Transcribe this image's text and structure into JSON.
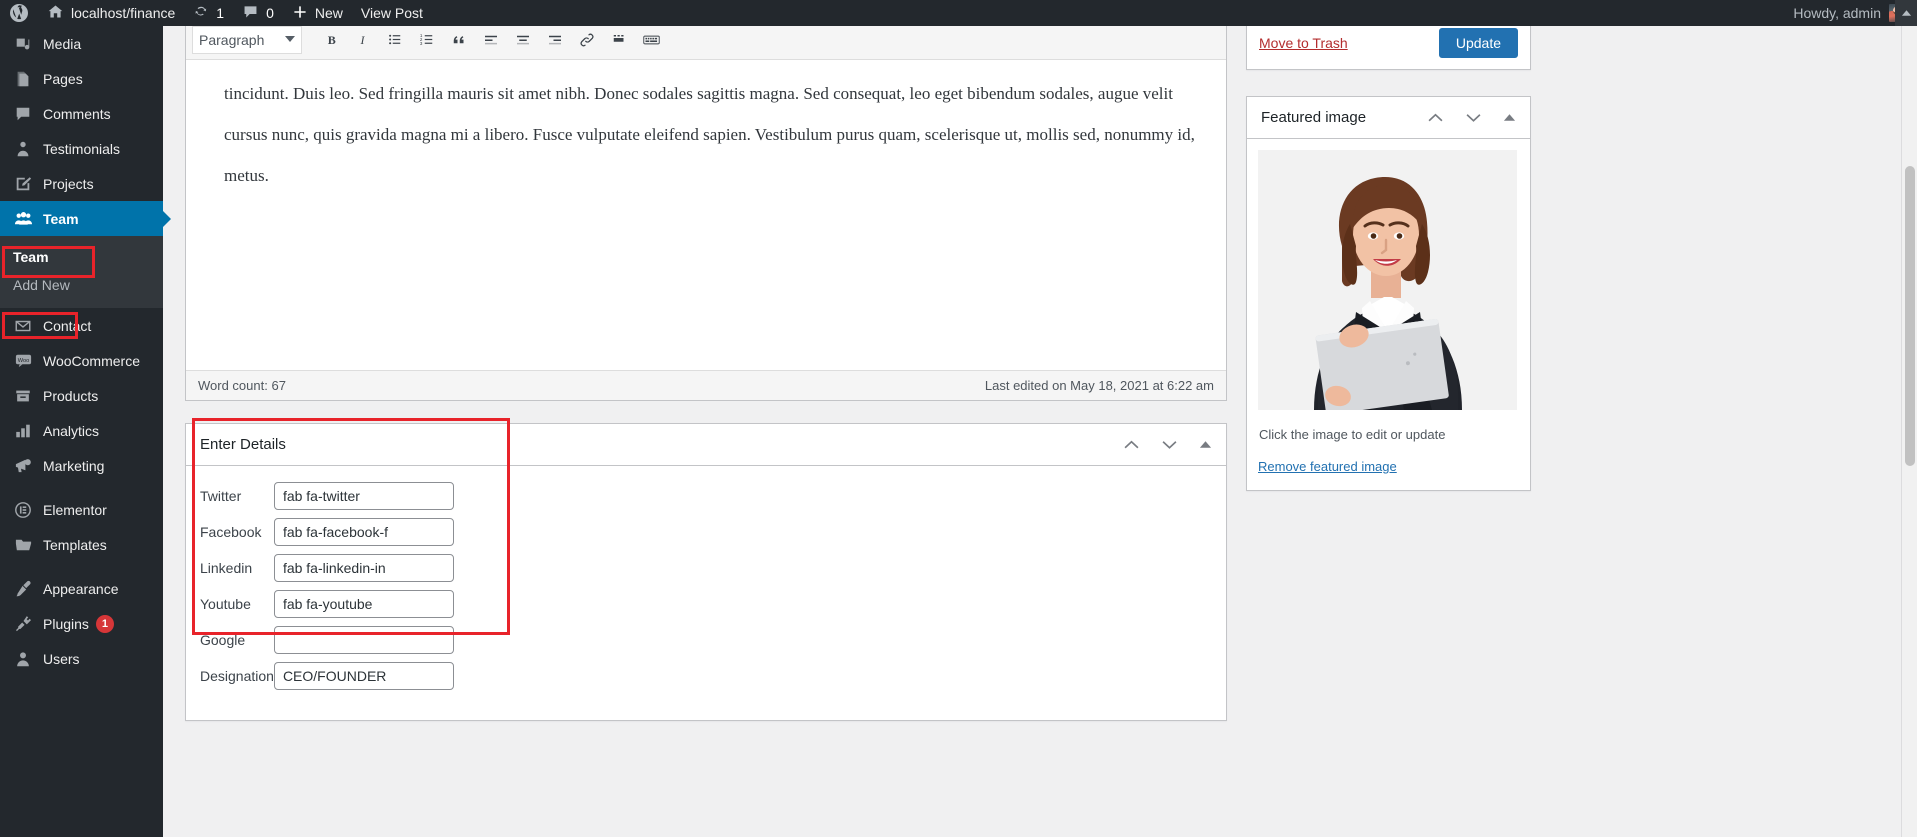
{
  "adminbar": {
    "logo_icon": "wordpress-logo-icon",
    "site_name": "localhost/finance",
    "site_icon": "home-icon",
    "updates_icon": "updates-icon",
    "updates_count": "1",
    "comments_icon": "comment-bubble-icon",
    "comments_count": "0",
    "new_icon": "plus-icon",
    "new_label": "New",
    "view_post_label": "View Post",
    "howdy": "Howdy, admin",
    "collapse_icon": "caret-up-icon"
  },
  "sidebar": {
    "items": [
      {
        "label": "Media",
        "icon": "media-icon",
        "current": false
      },
      {
        "label": "Pages",
        "icon": "pages-icon",
        "current": false
      },
      {
        "label": "Comments",
        "icon": "comments-icon",
        "current": false
      },
      {
        "label": "Testimonials",
        "icon": "testimonials-icon",
        "current": false
      },
      {
        "label": "Projects",
        "icon": "projects-icon",
        "current": false
      },
      {
        "label": "Team",
        "icon": "team-icon",
        "current": true
      }
    ],
    "team_submenu": [
      {
        "label": "Team",
        "current": true
      },
      {
        "label": "Add New",
        "current": false
      }
    ],
    "items2": [
      {
        "label": "Contact",
        "icon": "contact-envelope-icon"
      },
      {
        "label": "WooCommerce",
        "icon": "woocommerce-icon"
      },
      {
        "label": "Products",
        "icon": "products-icon"
      },
      {
        "label": "Analytics",
        "icon": "analytics-bars-icon"
      },
      {
        "label": "Marketing",
        "icon": "marketing-megaphone-icon"
      }
    ],
    "items3": [
      {
        "label": "Elementor",
        "icon": "elementor-icon"
      },
      {
        "label": "Templates",
        "icon": "templates-folder-icon"
      }
    ],
    "items4": [
      {
        "label": "Appearance",
        "icon": "appearance-brush-icon",
        "badge": ""
      },
      {
        "label": "Plugins",
        "icon": "plugins-plug-icon",
        "badge": "1"
      },
      {
        "label": "Users",
        "icon": "users-icon",
        "badge": ""
      }
    ]
  },
  "editor": {
    "format_select": "Paragraph",
    "toolbar_buttons": [
      "bold-icon",
      "italic-icon",
      "bulleted-list-icon",
      "numbered-list-icon",
      "blockquote-icon",
      "align-left-icon",
      "align-center-icon",
      "align-right-icon",
      "insert-link-icon",
      "read-more-icon",
      "keyboard-shortcuts-icon"
    ],
    "content_paragraph": "tincidunt. Duis leo. Sed fringilla mauris sit amet nibh. Donec sodales sagittis magna. Sed consequat, leo eget bibendum sodales, augue velit cursus nunc, quis gravida magna mi a libero. Fusce vulputate eleifend sapien. Vestibulum purus quam, scelerisque ut, mollis sed, nonummy id, metus.",
    "word_count": "Word count: 67",
    "last_edited": "Last edited on May 18, 2021 at 6:22 am"
  },
  "details_panel": {
    "title": "Enter Details",
    "move_up_icon": "chevron-up-icon",
    "move_down_icon": "chevron-down-icon",
    "toggle_icon": "toggle-panel-icon",
    "fields": [
      {
        "label": "Twitter",
        "value": "fab fa-twitter"
      },
      {
        "label": "Facebook",
        "value": "fab fa-facebook-f"
      },
      {
        "label": "Linkedin",
        "value": "fab fa-linkedin-in"
      },
      {
        "label": "Youtube",
        "value": "fab fa-youtube"
      },
      {
        "label": "Google",
        "value": ""
      },
      {
        "label": "Designation",
        "value": "CEO/FOUNDER"
      }
    ]
  },
  "publish_box": {
    "trash_label": "Move to Trash",
    "update_label": "Update"
  },
  "featured_image": {
    "title": "Featured image",
    "move_up_icon": "chevron-up-icon",
    "move_down_icon": "chevron-down-icon",
    "toggle_icon": "toggle-panel-icon",
    "image_alt": "smiling businesswoman in black suit holding a silver laptop",
    "caption": "Click the image to edit or update",
    "remove_label": "Remove featured image"
  },
  "colors": {
    "admin_bar": "#23282d",
    "menu_current": "#0073aa",
    "accent_button": "#2271b1",
    "highlight_box": "#e8232a",
    "trash_link": "#b32d2e",
    "badge": "#d63638"
  }
}
